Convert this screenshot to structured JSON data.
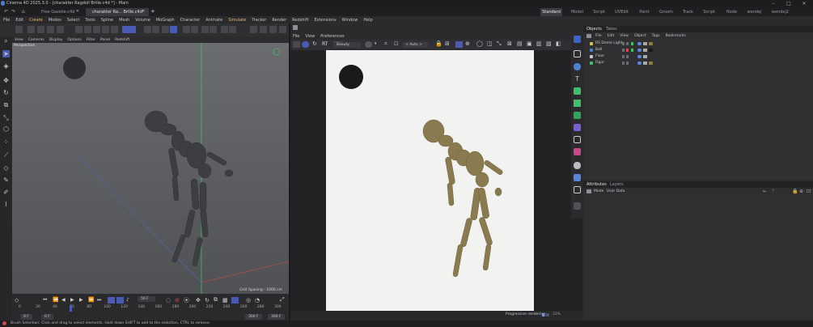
{
  "window": {
    "title": "Cinema 4D 2025.3.0 - [charakter Ragdoll Brille.c4d *] - Main"
  },
  "tabs": {
    "doc1": "Free Gazelle.c4d *",
    "doc2": "charakter Ra... Brille.c4d *",
    "layouts": [
      "Standard",
      "Model",
      "Script",
      "UVEdit",
      "Paint",
      "Groom",
      "Track",
      "Script",
      "Node",
      "wendej",
      "wendej2"
    ]
  },
  "menu": {
    "items": [
      "File",
      "Edit",
      "Create",
      "Modes",
      "Select",
      "Tools",
      "Spline",
      "Mesh",
      "Volume",
      "MoGraph",
      "Character",
      "Animate",
      "Simulate",
      "Tracker",
      "Render",
      "Redshift",
      "Extensions",
      "Window",
      "Help"
    ]
  },
  "viewport": {
    "menu": [
      "View",
      "Cameras",
      "Display",
      "Options",
      "Filter",
      "Panel",
      "Redshift"
    ],
    "label": "Perspective",
    "grid_spacing": "Grid Spacing : 1000 cm"
  },
  "timeline": {
    "current_frame_field": "50 F",
    "frames": [
      "0",
      "20",
      "40",
      "60",
      "80",
      "100",
      "120",
      "140",
      "160",
      "180",
      "200",
      "220",
      "240",
      "260",
      "280",
      "300"
    ],
    "start_a": "0 F",
    "start_b": "0 F",
    "end_a": "300 F",
    "end_b": "300 F"
  },
  "render_view": {
    "menu": [
      "File",
      "View",
      "Preferences"
    ],
    "rt_label": "RT",
    "quality_dropdown": "Beauty",
    "mode_dropdown": "< Auto >",
    "status_text": "Progressive rendering",
    "progress_percent": "33%",
    "progress_fraction": 0.33
  },
  "objects": {
    "tabs": [
      "Objects",
      "Takes"
    ],
    "menu": [
      "File",
      "Edit",
      "View",
      "Object",
      "Tags",
      "Bookmarks"
    ],
    "rows": [
      {
        "name": "RS Dome Light"
      },
      {
        "name": "Ball"
      },
      {
        "name": "Floor"
      },
      {
        "name": "Figur"
      }
    ]
  },
  "attributes": {
    "tabs": [
      "Attributes",
      "Layers"
    ],
    "menu": [
      "Mode",
      "User Data"
    ]
  },
  "statusbar": {
    "message": "Brush Selection: Click and drag to select elements. Hold down SHIFT to add to the selection, CTRL to remove."
  },
  "colors": {
    "accent_blue": "#4a5bb5",
    "figure_grey": "#3c3e41",
    "figure_render": "#8a7a4f",
    "axis_green": "#3fc46a",
    "axis_red": "#d24a4a"
  }
}
